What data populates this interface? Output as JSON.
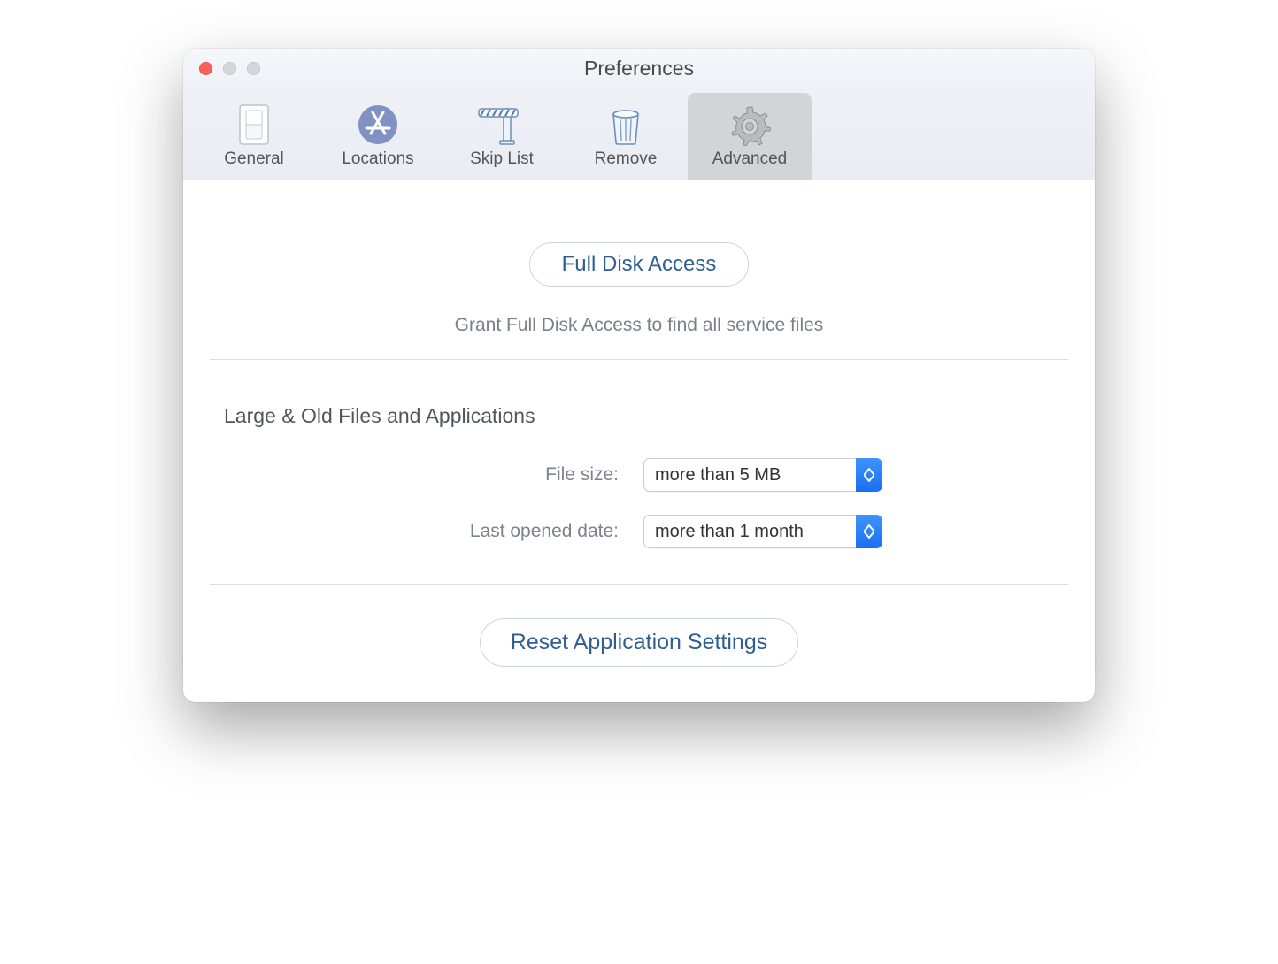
{
  "window": {
    "title": "Preferences"
  },
  "toolbar": {
    "tabs": [
      {
        "label": "General"
      },
      {
        "label": "Locations"
      },
      {
        "label": "Skip List"
      },
      {
        "label": "Remove"
      },
      {
        "label": "Advanced"
      }
    ]
  },
  "advanced": {
    "full_disk_button": "Full Disk Access",
    "full_disk_hint": "Grant Full Disk Access to find all service files",
    "section_title": "Large & Old Files and Applications",
    "file_size_label": "File size:",
    "file_size_value": "more than 5 MB",
    "last_opened_label": "Last opened date:",
    "last_opened_value": "more than 1 month",
    "reset_button": "Reset Application Settings"
  }
}
